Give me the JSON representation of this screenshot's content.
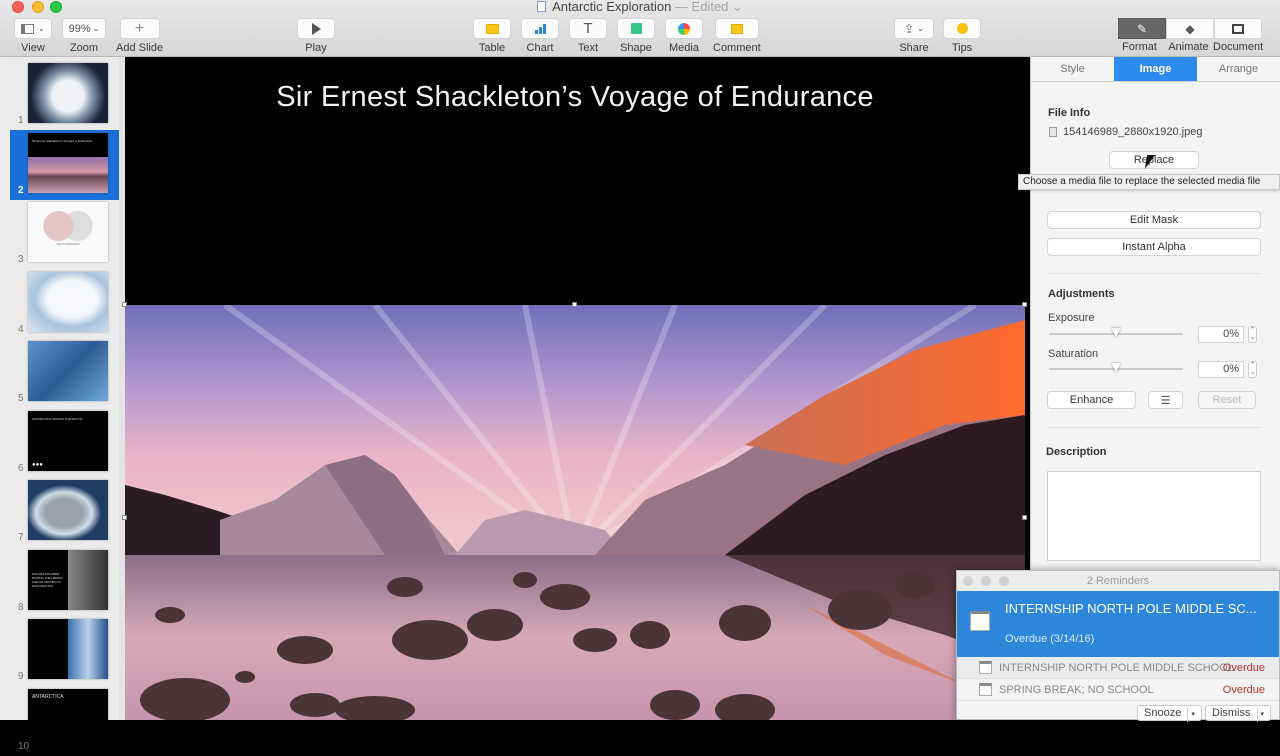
{
  "window": {
    "title": "Antarctic Exploration",
    "title_suffix": "— Edited ⌄"
  },
  "toolbar": {
    "view_label": "View",
    "zoom_value": "99%",
    "zoom_label": "Zoom",
    "add_slide_label": "Add Slide",
    "play_label": "Play",
    "table_label": "Table",
    "chart_label": "Chart",
    "text_label": "Text",
    "shape_label": "Shape",
    "media_label": "Media",
    "comment_label": "Comment",
    "share_label": "Share",
    "tips_label": "Tips",
    "format_label": "Format",
    "animate_label": "Animate",
    "document_label": "Document"
  },
  "navigator": {
    "selected": 2,
    "slides": [
      {
        "num": "1",
        "kind": "globe"
      },
      {
        "num": "2",
        "kind": "landscape",
        "caption": "Sir Ernest Shackleton's Voyage of Endurance"
      },
      {
        "num": "3",
        "kind": "venn",
        "caption": "VENN DIAGRAM"
      },
      {
        "num": "4",
        "kind": "map"
      },
      {
        "num": "5",
        "kind": "ice"
      },
      {
        "num": "6",
        "kind": "dark",
        "caption": "ANTARCTICA VERSUS THE ARCTIC"
      },
      {
        "num": "7",
        "kind": "map-usa"
      },
      {
        "num": "8",
        "kind": "portrait",
        "caption": "POLAR EXPLORER DURING THE HEROIC AGE OF ANTARCTIC EXPLORATION"
      },
      {
        "num": "9",
        "kind": "mountain-blue"
      },
      {
        "num": "10",
        "kind": "dark-title",
        "caption": "ANTARCTICA"
      }
    ]
  },
  "slide": {
    "title": "Sir Ernest Shackleton’s Voyage of Endurance"
  },
  "inspector": {
    "tabs": [
      {
        "label": "Style",
        "active": false
      },
      {
        "label": "Image",
        "active": true
      },
      {
        "label": "Arrange",
        "active": false
      }
    ],
    "file_info_label": "File Info",
    "file_name": "154146989_2880x1920.jpeg",
    "replace_label": "Replace",
    "tooltip": "Choose a media file to replace the selected media file",
    "edit_mask_label": "Edit Mask",
    "instant_alpha_label": "Instant Alpha",
    "adjustments_label": "Adjustments",
    "exposure_label": "Exposure",
    "exposure_value": "0%",
    "exposure_level": 0.5,
    "saturation_label": "Saturation",
    "saturation_value": "0%",
    "saturation_level": 0.5,
    "enhance_label": "Enhance",
    "reset_label": "Reset",
    "description_label": "Description",
    "description_value": ""
  },
  "reminders": {
    "title": "2 Reminders",
    "main_title": "INTERNSHIP NORTH POLE MIDDLE SC...",
    "main_sub": "Overdue (3/14/16)",
    "items": [
      {
        "text": "INTERNSHIP NORTH POLE MIDDLE SCHOOL",
        "status": "Overdue"
      },
      {
        "text": "SPRING BREAK; NO SCHOOL",
        "status": "Overdue"
      }
    ],
    "snooze_label": "Snooze",
    "dismiss_label": "Dismiss"
  },
  "colors": {
    "accent": "#2d8ced",
    "selection": "#1a6fd9",
    "overdue": "#b5332f"
  }
}
